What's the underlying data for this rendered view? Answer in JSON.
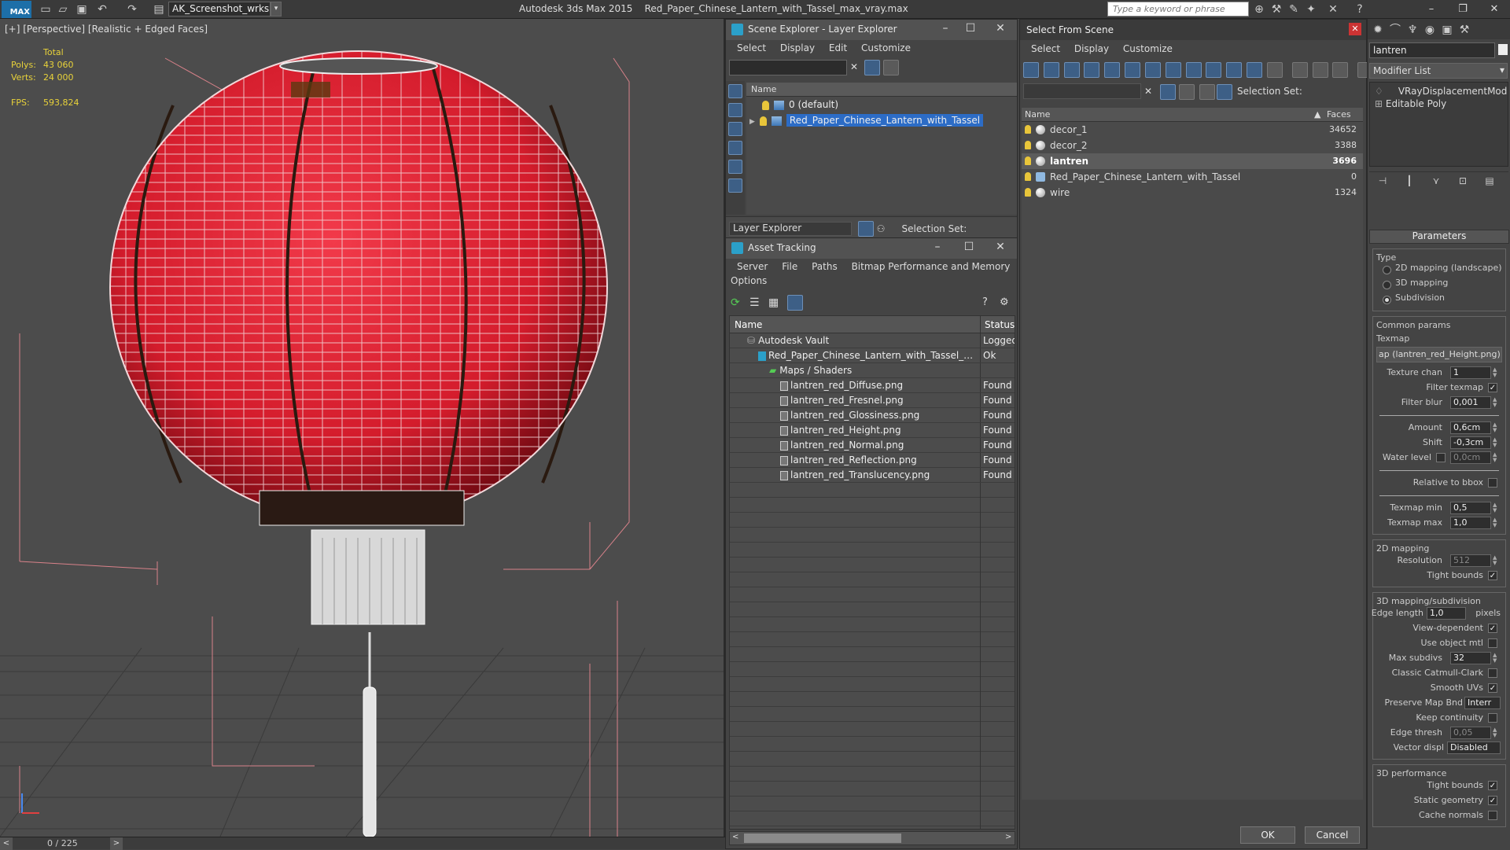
{
  "titlebar": {
    "logo": "MAX",
    "workspace": "AK_Screenshot_wrksp",
    "app": "Autodesk 3ds Max  2015",
    "file": "Red_Paper_Chinese_Lantern_with_Tassel_max_vray.max",
    "search_placeholder": "Type a keyword or phrase"
  },
  "viewport": {
    "label": "[+] [Perspective] [Realistic + Edged Faces]",
    "stats": {
      "total_label": "Total",
      "polys_label": "Polys:",
      "polys": "43 060",
      "verts_label": "Verts:",
      "verts": "24 000",
      "fps_label": "FPS:",
      "fps": "593,824"
    },
    "timeline_frame": "0 / 225"
  },
  "layer_explorer": {
    "title": "Scene Explorer - Layer Explorer",
    "menu": [
      "Select",
      "Display",
      "Edit",
      "Customize"
    ],
    "column_name": "Name",
    "layers": [
      {
        "name": "0 (default)",
        "selected": false
      },
      {
        "name": "Red_Paper_Chinese_Lantern_with_Tassel",
        "selected": true
      }
    ],
    "footer_dropdown": "Layer Explorer",
    "selection_set_label": "Selection Set:"
  },
  "asset_tracking": {
    "title": "Asset Tracking",
    "menu": [
      "Server",
      "File",
      "Paths",
      "Bitmap Performance and Memory",
      "Options"
    ],
    "col_name": "Name",
    "col_status": "Status",
    "rows": [
      {
        "name": "Autodesk Vault",
        "status": "Logged",
        "indent": 1
      },
      {
        "name": "Red_Paper_Chinese_Lantern_with_Tassel_max_v...",
        "status": "Ok",
        "indent": 2
      },
      {
        "name": "Maps / Shaders",
        "status": "",
        "indent": 3
      },
      {
        "name": "lantren_red_Diffuse.png",
        "status": "Found",
        "indent": 4
      },
      {
        "name": "lantren_red_Fresnel.png",
        "status": "Found",
        "indent": 4
      },
      {
        "name": "lantren_red_Glossiness.png",
        "status": "Found",
        "indent": 4
      },
      {
        "name": "lantren_red_Height.png",
        "status": "Found",
        "indent": 4
      },
      {
        "name": "lantren_red_Normal.png",
        "status": "Found",
        "indent": 4
      },
      {
        "name": "lantren_red_Reflection.png",
        "status": "Found",
        "indent": 4
      },
      {
        "name": "lantren_red_Translucency.png",
        "status": "Found",
        "indent": 4
      }
    ]
  },
  "select_from_scene": {
    "title": "Select From Scene",
    "menu": [
      "Select",
      "Display",
      "Customize"
    ],
    "selection_set_label": "Selection Set:",
    "col_name": "Name",
    "col_faces": "Faces",
    "rows": [
      {
        "name": "decor_1",
        "faces": "34652",
        "highlight": false
      },
      {
        "name": "decor_2",
        "faces": "3388",
        "highlight": false
      },
      {
        "name": "lantren",
        "faces": "3696",
        "highlight": true
      },
      {
        "name": "Red_Paper_Chinese_Lantern_with_Tassel",
        "faces": "0",
        "highlight": false
      },
      {
        "name": "wire",
        "faces": "1324",
        "highlight": false
      }
    ],
    "ok": "OK",
    "cancel": "Cancel"
  },
  "command_panel": {
    "object_name": "lantren",
    "modifier_list": "Modifier List",
    "stack": [
      "VRayDisplacementMod",
      "Editable Poly"
    ],
    "rollout": "Parameters",
    "type_label": "Type",
    "type_options": [
      "2D mapping (landscape)",
      "3D mapping",
      "Subdivision"
    ],
    "common_params": "Common params",
    "texmap_label": "Texmap",
    "texmap_value": "ap (lantren_red_Height.png)",
    "texture_chan_label": "Texture chan",
    "texture_chan": "1",
    "filter_texmap_label": "Filter texmap",
    "filter_blur_label": "Filter blur",
    "filter_blur": "0,001",
    "amount_label": "Amount",
    "amount": "0,6cm",
    "shift_label": "Shift",
    "shift": "-0,3cm",
    "water_level_label": "Water level",
    "water_level": "0,0cm",
    "relative_bbox_label": "Relative to bbox",
    "texmap_min_label": "Texmap min",
    "texmap_min": "0,5",
    "texmap_max_label": "Texmap max",
    "texmap_max": "1,0",
    "mapping2d": "2D mapping",
    "resolution_label": "Resolution",
    "resolution": "512",
    "tight_bounds_label": "Tight bounds",
    "mapping3d": "3D mapping/subdivision",
    "edge_length_label": "Edge length",
    "edge_length": "1,0",
    "pixels_label": "pixels",
    "view_dependent_label": "View-dependent",
    "use_object_mtl_label": "Use object mtl",
    "max_subdivs_label": "Max subdivs",
    "max_subdivs": "32",
    "catmull_label": "Classic Catmull-Clark",
    "smooth_uvs_label": "Smooth UVs",
    "preserve_map_label": "Preserve Map Bnd",
    "preserve_map": "Interr",
    "keep_continuity_label": "Keep continuity",
    "edge_thresh_label": "Edge thresh",
    "edge_thresh": "0,05",
    "vector_displ_label": "Vector displ",
    "vector_displ": "Disabled",
    "perf3d": "3D performance",
    "tight_bounds2_label": "Tight bounds",
    "static_geometry_label": "Static geometry",
    "cache_normals_label": "Cache normals"
  }
}
